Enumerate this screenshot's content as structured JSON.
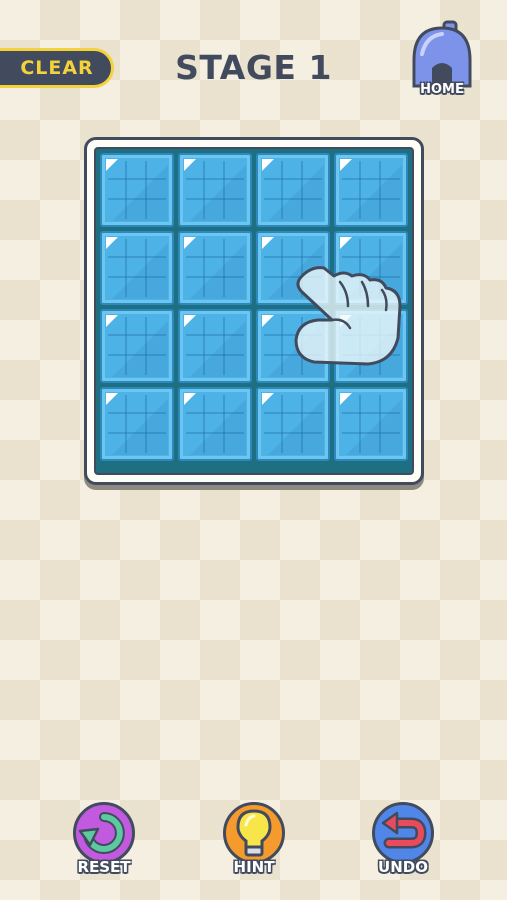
{
  "header": {
    "clear_label": "CLEAR",
    "stage_title": "STAGE 1",
    "home_label": "HOME"
  },
  "board": {
    "rows": 4,
    "cols": 4,
    "tile_color": "#4db2e6",
    "frame_color": "#1f6f82"
  },
  "footer": {
    "reset_label": "RESET",
    "hint_label": "HINT",
    "undo_label": "UNDO"
  },
  "icons": {
    "home": "home-icon",
    "reset": "reset-arrow-icon",
    "hint": "lightbulb-icon",
    "undo": "undo-arrow-icon",
    "tutorial": "pointing-hand-icon"
  },
  "colors": {
    "background": "#f4efe0",
    "text_dark": "#424b5e",
    "clear_accent": "#f3d23c",
    "home": "#7d93ea",
    "reset": "#c25ae0",
    "reset_arrow": "#5cc9a0",
    "hint": "#f59a2d",
    "hint_bulb": "#f8e54a",
    "undo": "#4f86e8",
    "undo_arrow": "#ea4b5c"
  }
}
